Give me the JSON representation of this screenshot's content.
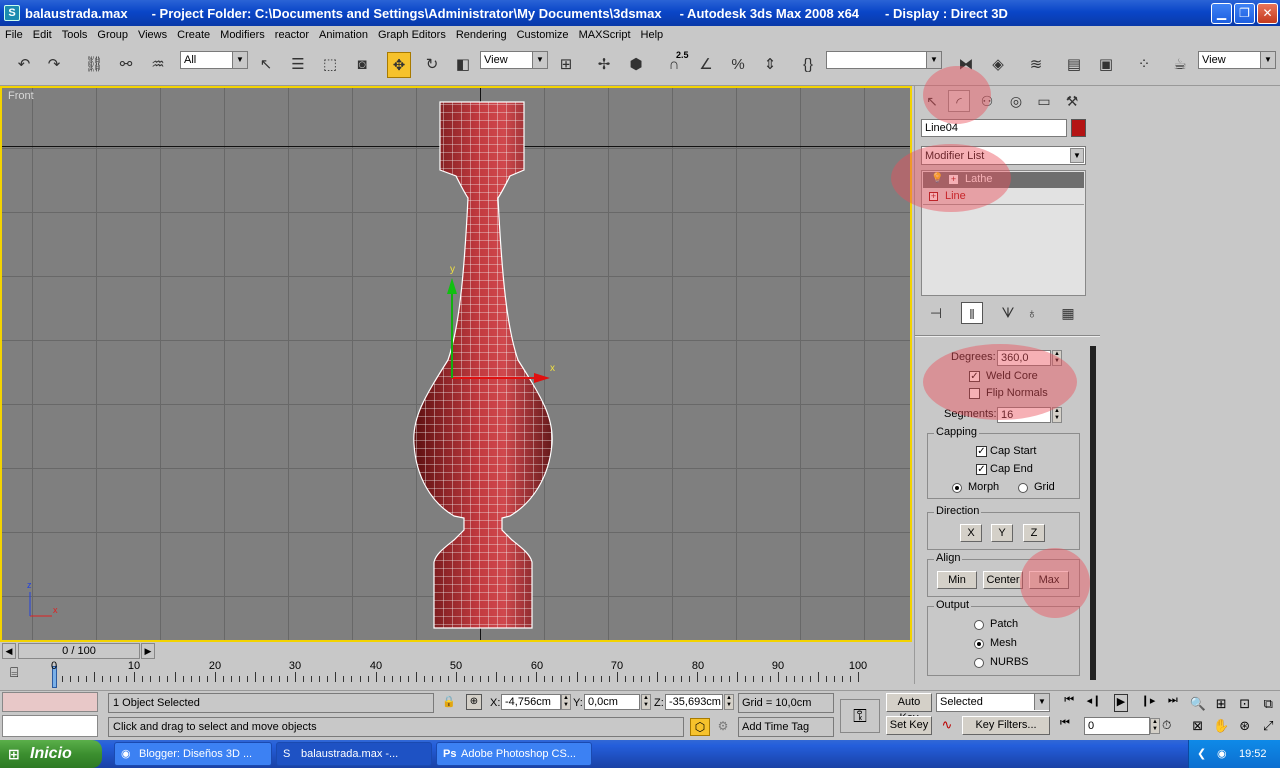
{
  "window": {
    "file": "balaustrada.max",
    "project_folder": "- Project Folder: C:\\Documents and Settings\\Administrator\\My Documents\\3dsmax",
    "app": "- Autodesk 3ds Max 2008 x64",
    "display": "- Display : Direct 3D"
  },
  "menu": [
    "File",
    "Edit",
    "Tools",
    "Group",
    "Views",
    "Create",
    "Modifiers",
    "reactor",
    "Animation",
    "Graph Editors",
    "Rendering",
    "Customize",
    "MAXScript",
    "Help"
  ],
  "toolbar": {
    "selection_filter": "All",
    "ref_coord": "View",
    "snap_label": "2.5",
    "named_selection": "",
    "view_right": "View"
  },
  "viewport": {
    "label": "Front",
    "gizmo_x": "x",
    "gizmo_y": "y",
    "corner_x": "x",
    "corner_z": "z"
  },
  "panel": {
    "object_name": "Line04",
    "object_color": "#b41414",
    "modifier_list": "Modifier List",
    "stack": [
      {
        "label": "Lathe",
        "selected": true
      },
      {
        "label": "Line",
        "selected": false
      }
    ],
    "degrees_label": "Degrees:",
    "degrees_value": "360,0",
    "weld_core": "Weld Core",
    "flip_normals": "Flip Normals",
    "segments_label": "Segments:",
    "segments_value": "16",
    "capping_title": "Capping",
    "cap_start": "Cap Start",
    "cap_end": "Cap End",
    "morph": "Morph",
    "grid": "Grid",
    "direction_title": "Direction",
    "dir_x": "X",
    "dir_y": "Y",
    "dir_z": "Z",
    "align_title": "Align",
    "align_min": "Min",
    "align_center": "Center",
    "align_max": "Max",
    "output_title": "Output",
    "out_patch": "Patch",
    "out_mesh": "Mesh",
    "out_nurbs": "NURBS"
  },
  "timeline": {
    "frame": "0 / 100",
    "ticks": [
      "0",
      "10",
      "20",
      "30",
      "40",
      "50",
      "60",
      "70",
      "80",
      "90",
      "100"
    ]
  },
  "status": {
    "selected": "1 Object Selected",
    "prompt": "Click and drag to select and move objects",
    "x_label": "X:",
    "x_value": "-4,756cm",
    "y_label": "Y:",
    "y_value": "0,0cm",
    "z_label": "Z:",
    "z_value": "-35,693cm",
    "grid": "Grid = 10,0cm",
    "add_time_tag": "Add Time Tag",
    "auto_key": "Auto Key",
    "set_key": "Set Key",
    "key_mode": "Selected",
    "key_filters": "Key Filters...",
    "frame_field": "0"
  },
  "taskbar": {
    "start": "Inicio",
    "tasks": [
      "Blogger: Diseños 3D ...",
      "balaustrada.max     -...",
      "Adobe Photoshop CS..."
    ],
    "clock": "19:52"
  }
}
